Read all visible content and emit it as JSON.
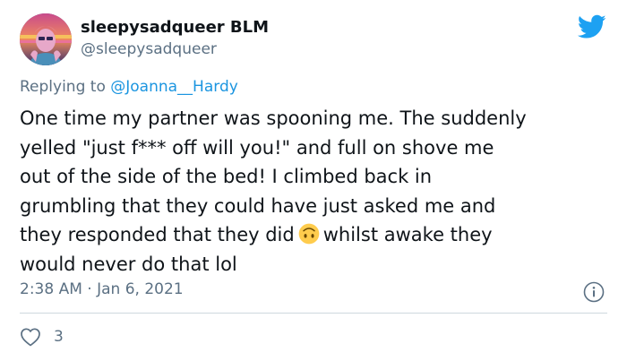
{
  "user": {
    "display_name": "sleepysadqueer BLM",
    "handle": "@sleepysadqueer"
  },
  "reply": {
    "prefix": "Replying to ",
    "mention": "@Joanna__Hardy"
  },
  "tweet": {
    "text_before_emoji": "One time my partner was spooning me. The suddenly\nyelled \"just f***  off will you!\" and full on shove me\nout of the side of the bed! I climbed back in\ngrumbling that they could have just asked me and\nthey responded that they did",
    "emoji_name": "upside-down-face-emoji",
    "text_after_emoji": "whilst awake they\nwould never do that lol"
  },
  "meta": {
    "timestamp": "2:38 AM · Jan 6, 2021"
  },
  "engagement": {
    "likes": "3"
  },
  "icons": {
    "brand": "twitter-bird-icon",
    "info": "info-icon",
    "like": "heart-icon"
  },
  "colors": {
    "twitter_blue": "#1da1f2",
    "secondary_text": "#5b7083",
    "mention": "#1b95e0",
    "emoji_yellow": "#ffcc4d"
  }
}
